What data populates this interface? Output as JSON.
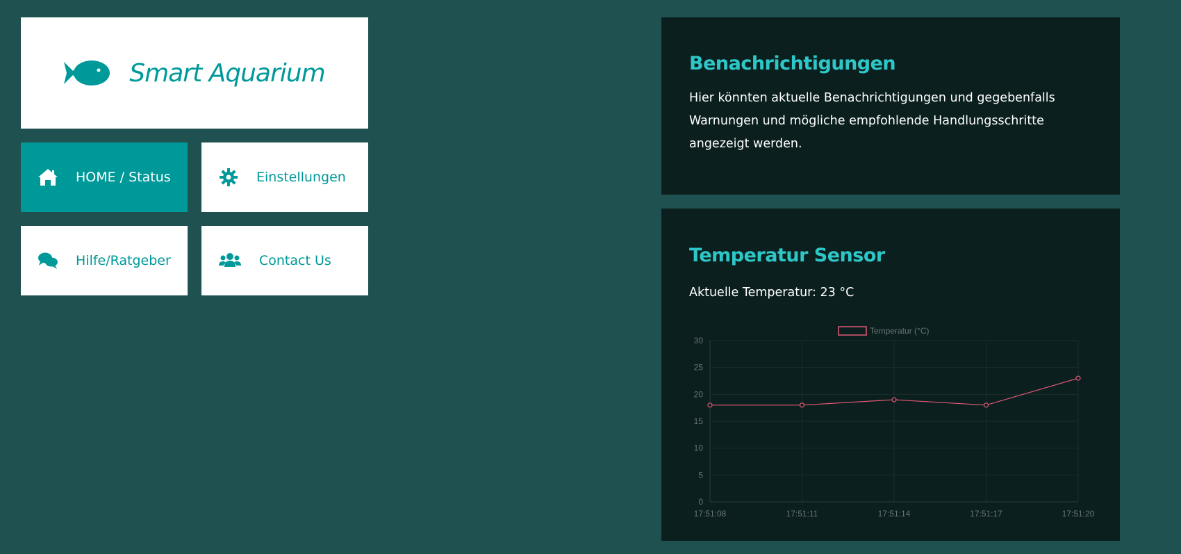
{
  "brand": {
    "title": "Smart Aquarium",
    "icon": "fish-icon",
    "color": "#009999"
  },
  "nav": {
    "items": [
      {
        "label": "HOME / Status",
        "icon": "home-icon",
        "active": true
      },
      {
        "label": "Einstellungen",
        "icon": "gear-icon",
        "active": false
      },
      {
        "label": "Hilfe/Ratgeber",
        "icon": "comments-icon",
        "active": false
      },
      {
        "label": "Contact Us",
        "icon": "users-icon",
        "active": false
      }
    ]
  },
  "notifications": {
    "title": "Benachrichtigungen",
    "text": "Hier könnten aktuelle Benachrichtigungen und gegebenfalls Warnungen und mögliche empfohlende Handlungsschritte angezeigt werden."
  },
  "temperature": {
    "title": "Temperatur Sensor",
    "current_label": "Aktuelle Temperatur: 23 °C"
  },
  "colors": {
    "background": "#1f5151",
    "panel": "#0b1f1f",
    "accent": "#2ec7c7",
    "series": "#e05a75"
  },
  "chart_data": {
    "type": "line",
    "title": "",
    "xlabel": "",
    "ylabel": "",
    "legend_position": "top",
    "grid": true,
    "x": [
      "17:51:08",
      "17:51:11",
      "17:51:14",
      "17:51:17",
      "17:51:20"
    ],
    "series": [
      {
        "name": "Temperatur (°C)",
        "values": [
          18,
          18,
          19,
          18,
          23
        ]
      }
    ],
    "ylim": [
      0,
      30
    ],
    "yticks": [
      "0",
      "5",
      "10",
      "15",
      "20",
      "25",
      "30"
    ]
  }
}
